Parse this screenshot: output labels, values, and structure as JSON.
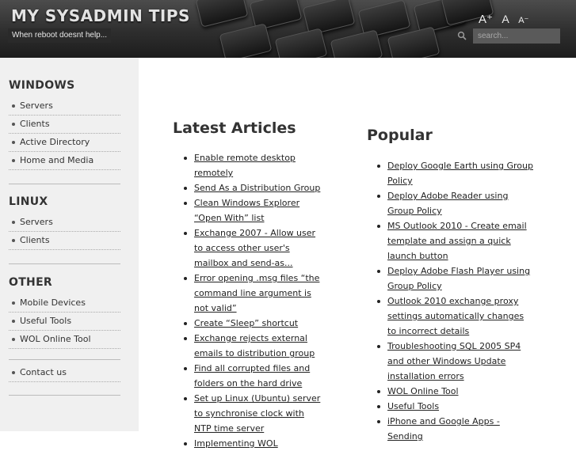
{
  "header": {
    "site_title": "MY SYSADMIN TIPS",
    "tagline": "When reboot doesnt help...",
    "font_tools": {
      "increase": "A⁺",
      "reset": "A",
      "decrease": "A⁻"
    },
    "search_placeholder": "search...",
    "search_icon": "magnifier-icon"
  },
  "sidebar": {
    "sections": [
      {
        "heading": "WINDOWS",
        "items": [
          "Servers",
          "Clients",
          "Active Directory",
          "Home and Media"
        ]
      },
      {
        "heading": "LINUX",
        "items": [
          "Servers",
          "Clients"
        ]
      },
      {
        "heading": "OTHER",
        "items": [
          "Mobile Devices",
          "Useful Tools",
          "WOL Online Tool"
        ]
      },
      {
        "heading": "",
        "items": [
          "Contact us"
        ]
      }
    ]
  },
  "latest": {
    "title": "Latest Articles",
    "items": [
      "Enable remote desktop remotely",
      "Send As a Distribution Group",
      "Clean Windows Explorer “Open With” list",
      "Exchange 2007 - Allow user to access other user's mailbox and send-as...",
      "Error opening .msg files “the command line argument is not valid”",
      "Create “Sleep” shortcut",
      "Exchange rejects external emails to distribution group",
      "Find all corrupted files and folders on the hard drive",
      "Set up Linux (Ubuntu) server to synchronise clock with NTP time server",
      "Implementing WOL"
    ]
  },
  "popular": {
    "title": "Popular",
    "items": [
      "Deploy Google Earth using Group Policy",
      "Deploy Adobe Reader using Group Policy",
      "MS Outlook 2010 - Create email template and assign a quick launch button",
      "Deploy Adobe Flash Player using Group Policy",
      "Outlook 2010 exchange proxy settings automatically changes to incorrect details",
      "Troubleshooting SQL 2005 SP4 and other Windows Update installation errors",
      "WOL Online Tool",
      "Useful Tools",
      "iPhone and Google Apps - Sending"
    ]
  },
  "colors": {
    "header_bg": "#2e2e2e",
    "sidebar_bg": "#f0f0f0",
    "text": "#222222"
  }
}
